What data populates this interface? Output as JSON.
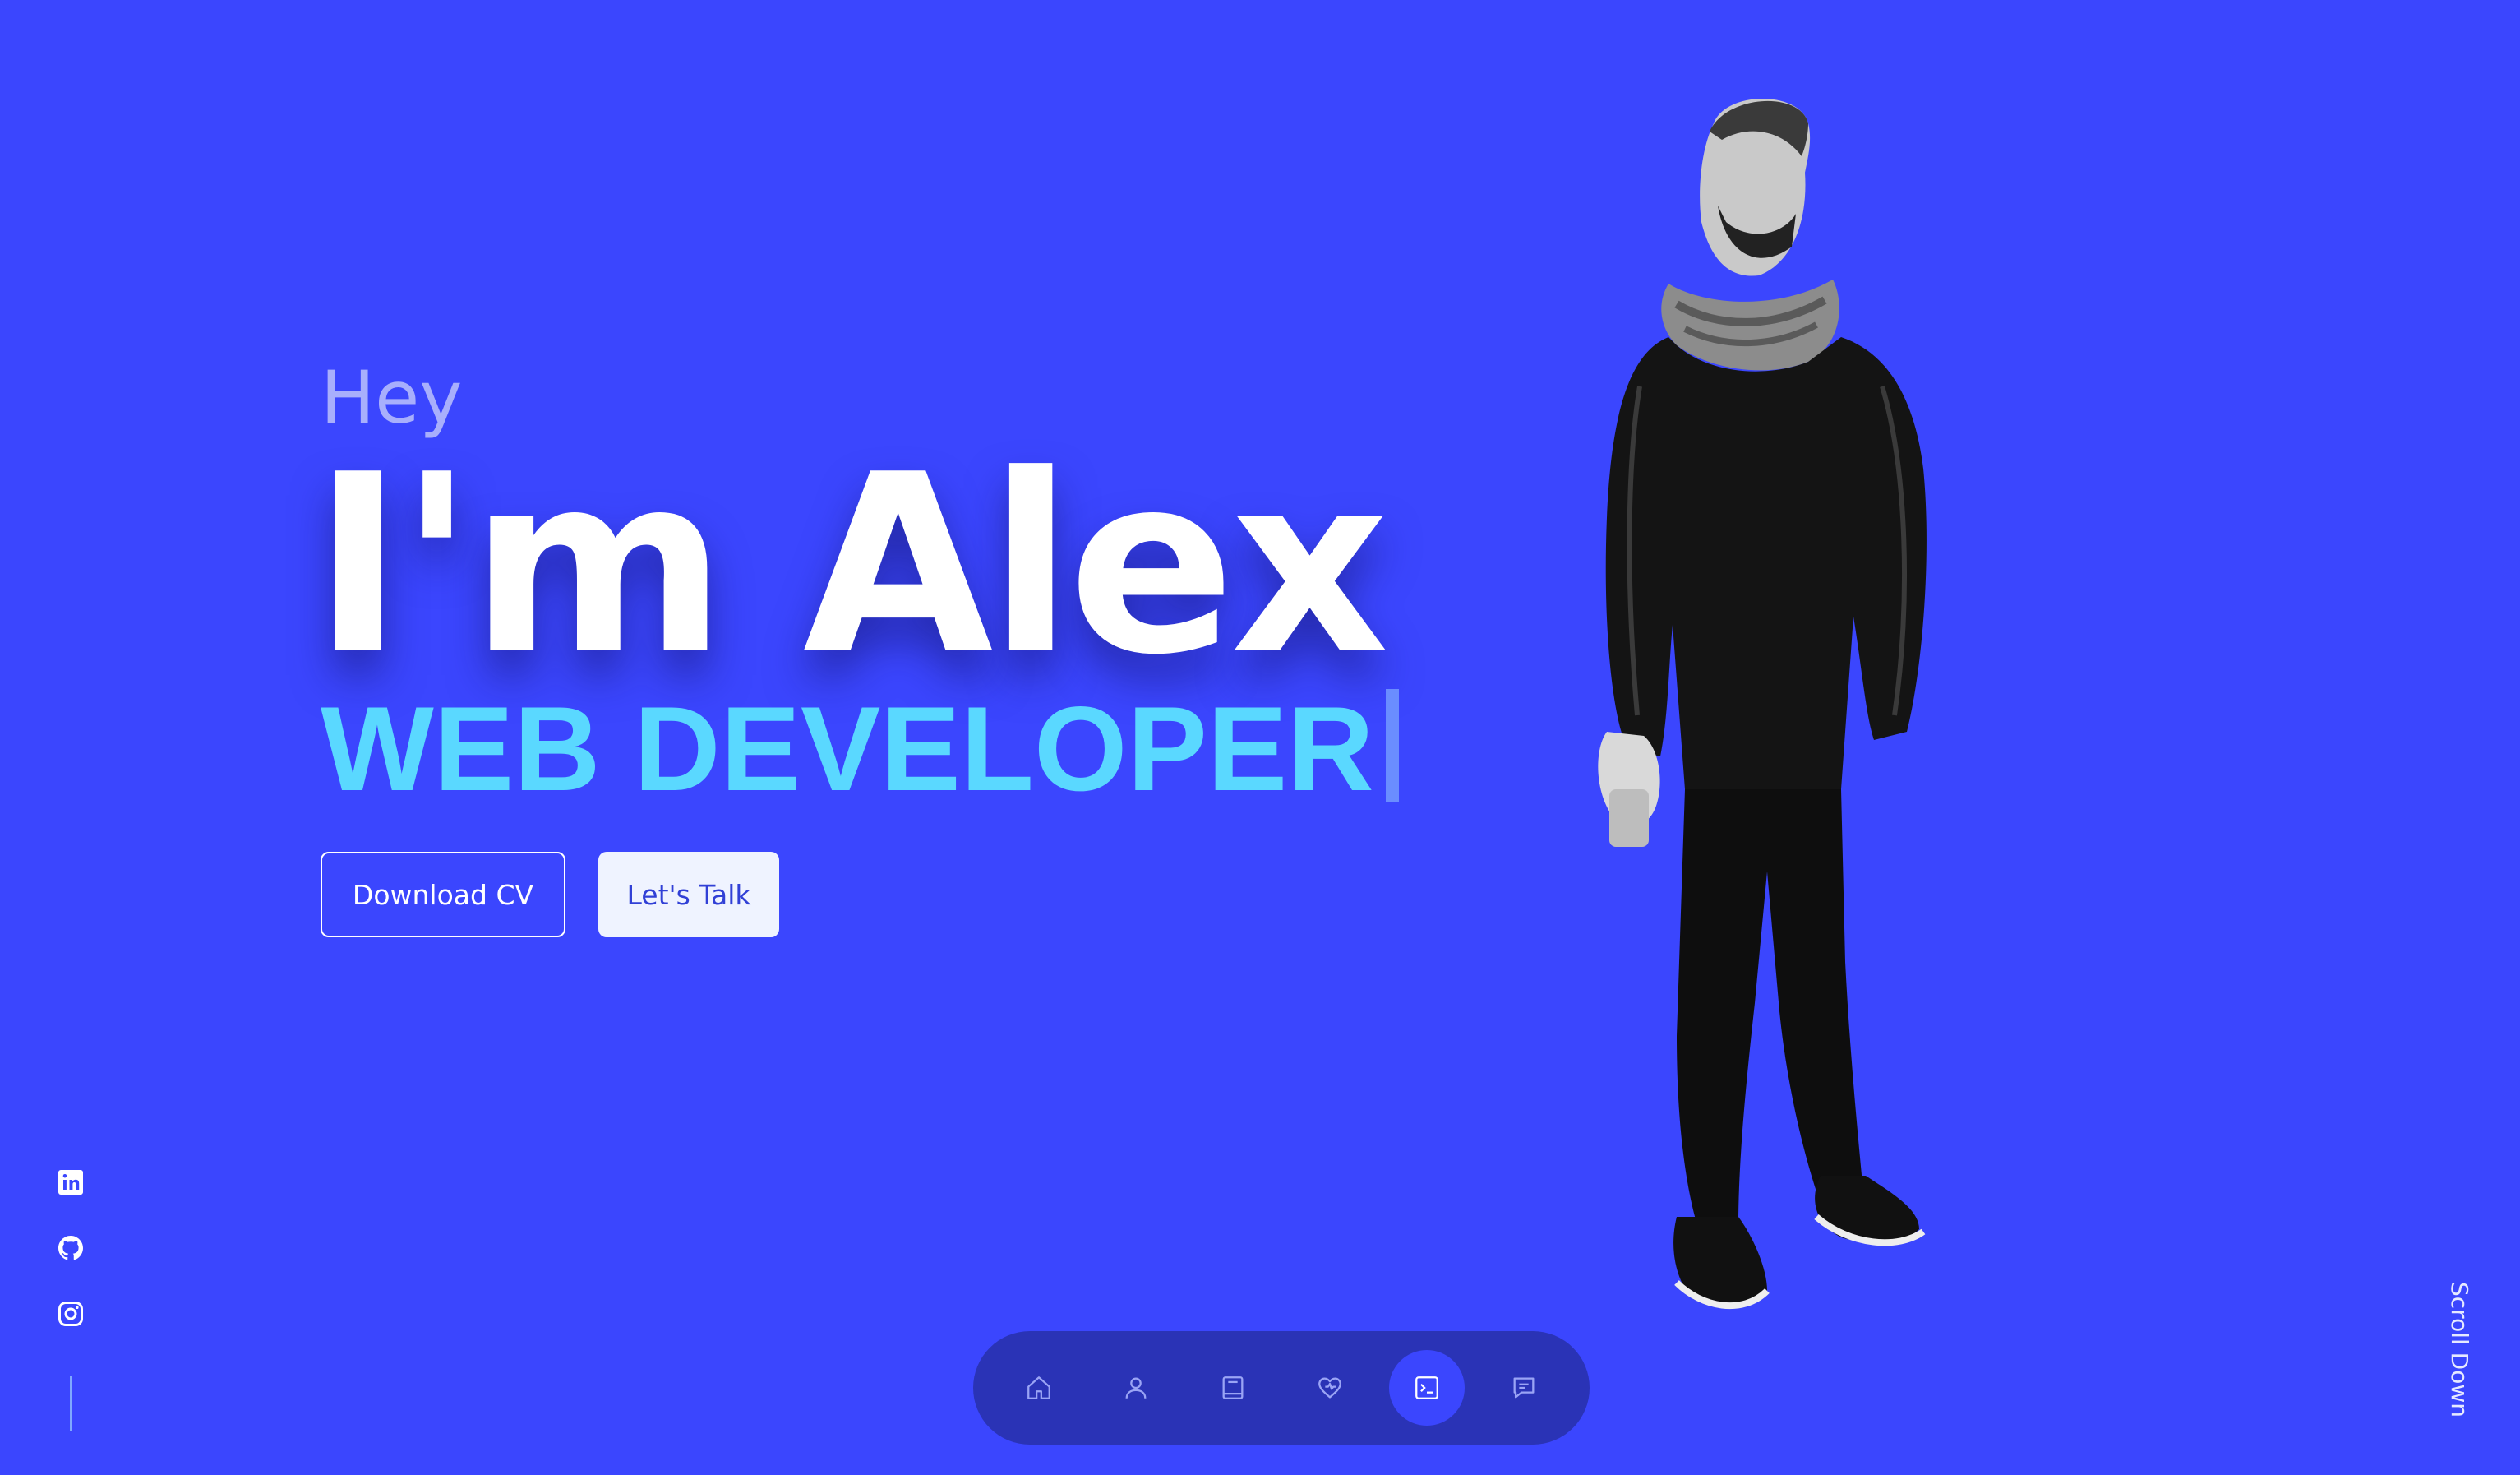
{
  "hero": {
    "greeting": "Hey",
    "name": "I'm Alex",
    "role": "WEB DEVELOPER",
    "buttons": {
      "download_cv": "Download CV",
      "lets_talk": "Let's Talk"
    }
  },
  "portrait": {
    "description": "Black and white photo of a bearded man in a dark coat and scarf"
  },
  "socials": [
    "linkedin-icon",
    "github-icon",
    "instagram-icon"
  ],
  "scroll": {
    "label": "Scroll Down"
  },
  "nav": {
    "items": [
      "home-icon",
      "user-icon",
      "book-icon",
      "heart-icon",
      "terminal-icon",
      "message-icon"
    ],
    "active": "terminal-icon"
  },
  "colors": {
    "background": "#3b46fe",
    "accent": "#5ad8ff",
    "nav_bg": "#2a33b6",
    "greeting": "#a8affc"
  }
}
